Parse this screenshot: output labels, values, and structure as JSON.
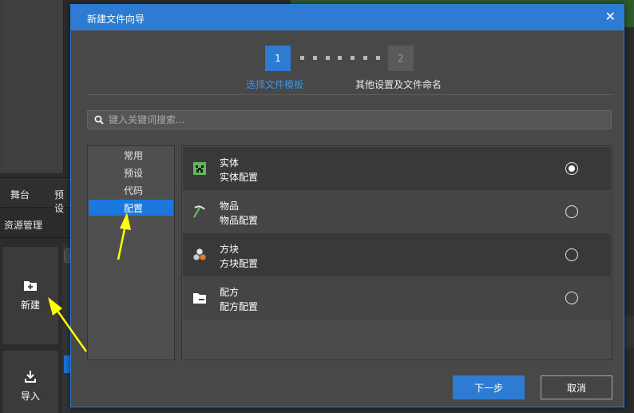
{
  "background": {
    "tabs": [
      "舞台",
      "预设"
    ],
    "resource_title": "资源管理",
    "tiles": [
      {
        "icon": "new-folder-icon",
        "label": "新建"
      },
      {
        "icon": "import-icon",
        "label": "导入"
      }
    ]
  },
  "dialog": {
    "title": "新建文件向导",
    "close_label": "✕",
    "steps": [
      {
        "number": "1",
        "label": "选择文件模板",
        "active": true
      },
      {
        "number": "2",
        "label": "其他设置及文件命名",
        "active": false
      }
    ],
    "search": {
      "placeholder": "键入关键词搜索..."
    },
    "categories": [
      "常用",
      "预设",
      "代码",
      "配置"
    ],
    "selected_category": "配置",
    "templates": [
      {
        "name": "实体",
        "desc": "实体配置",
        "icon": "creeper-entity-icon",
        "selected": true
      },
      {
        "name": "物品",
        "desc": "物品配置",
        "icon": "pickaxe-item-icon",
        "selected": false
      },
      {
        "name": "方块",
        "desc": "方块配置",
        "icon": "blocks-icon",
        "selected": false
      },
      {
        "name": "配方",
        "desc": "配方配置",
        "icon": "folder-recipe-icon",
        "selected": false
      }
    ],
    "buttons": {
      "next": "下一步",
      "cancel": "取消"
    }
  },
  "colors": {
    "accent": "#2d7bd2",
    "active_step_label": "#3c93e8",
    "annotation_arrow": "#ffff00"
  }
}
